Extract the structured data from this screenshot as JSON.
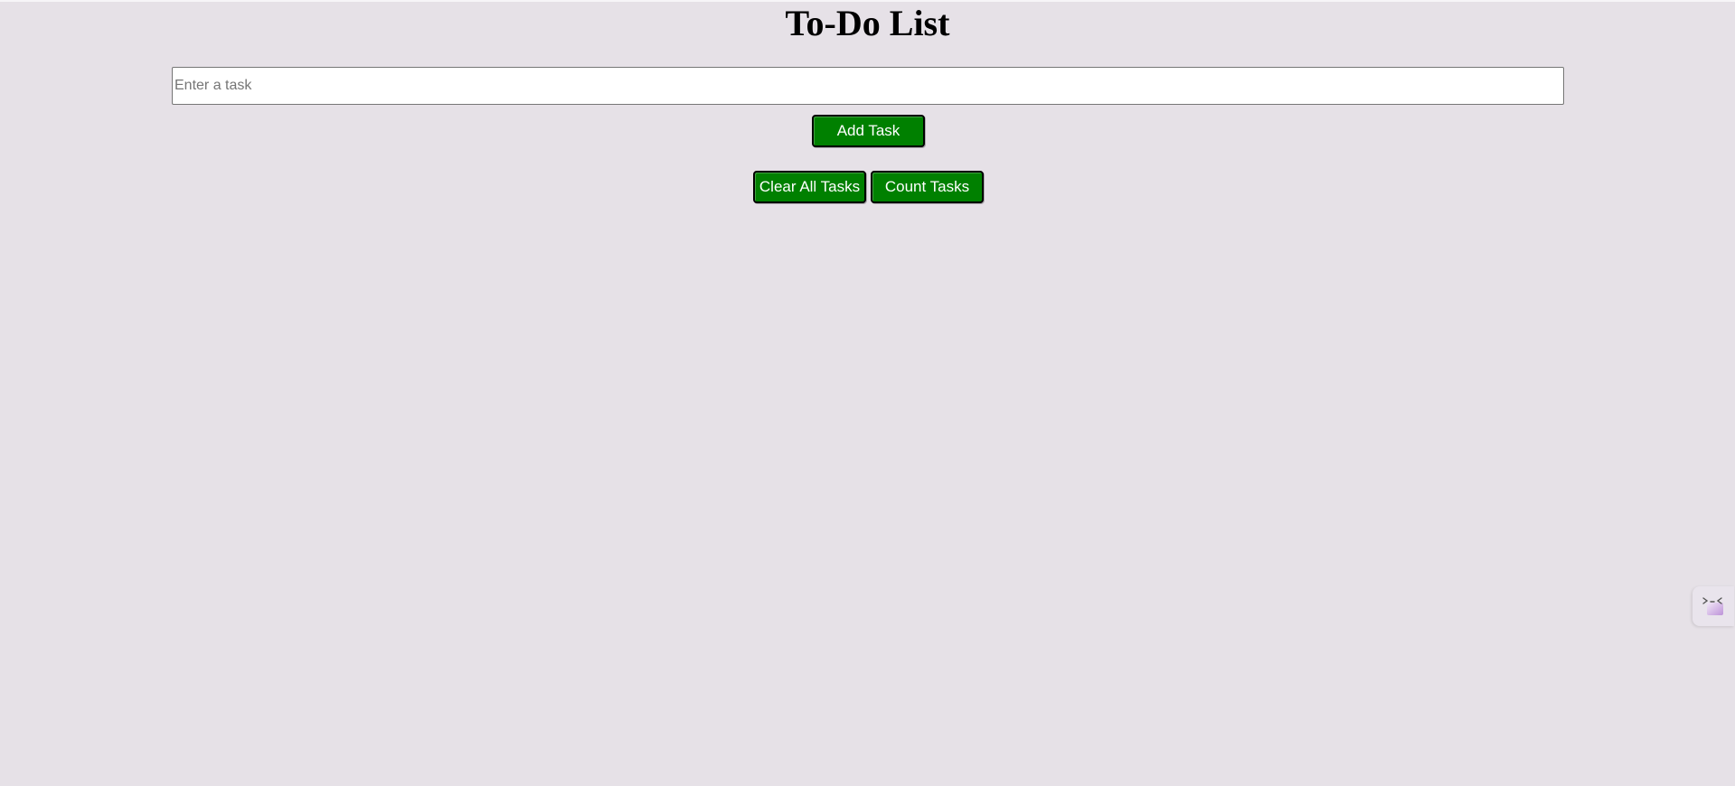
{
  "page": {
    "title": "To-Do List"
  },
  "task_form": {
    "input_value": "",
    "input_placeholder": "Enter a task",
    "add_label": "Add Task"
  },
  "actions": {
    "clear_label": "Clear All Tasks",
    "count_label": "Count Tasks"
  },
  "tasks": [],
  "colors": {
    "background": "#e6e1e7",
    "button": "#008000",
    "button_text": "#ffffff",
    "button_border": "#000000"
  },
  "icons": {
    "assistant_widget": "assistant-face-icon"
  }
}
